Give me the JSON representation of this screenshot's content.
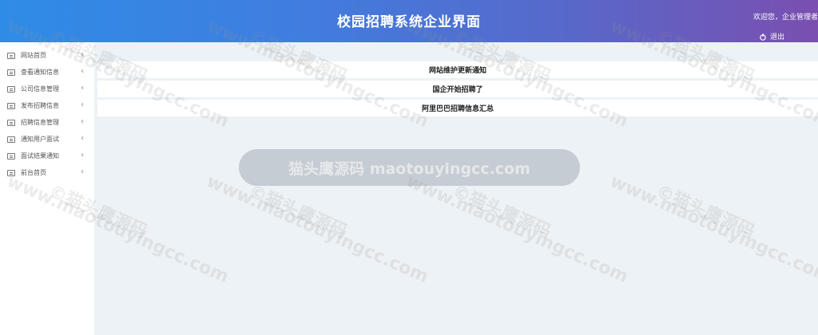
{
  "header": {
    "title": "校园招聘系统企业界面",
    "welcome": "欢迎您，企业管理者",
    "logout_label": "退出"
  },
  "sidebar": {
    "items": [
      {
        "label": "网站首页"
      },
      {
        "label": "查看通知信息"
      },
      {
        "label": "公司信息管理"
      },
      {
        "label": "发布招聘信息"
      },
      {
        "label": "招聘信息管理"
      },
      {
        "label": "通知用户面试"
      },
      {
        "label": "面试结果通知"
      },
      {
        "label": "前台首页"
      }
    ]
  },
  "main": {
    "notices": [
      {
        "text": "网站维护更新通知"
      },
      {
        "text": "国企开始招聘了"
      },
      {
        "text": "阿里巴巴招聘信息汇总"
      }
    ]
  },
  "watermark": {
    "brand": "©猫头鹰源码",
    "url": "www.maotouyingcc.com",
    "banner": "猫头鹰源码 maotouyingcc.com"
  }
}
